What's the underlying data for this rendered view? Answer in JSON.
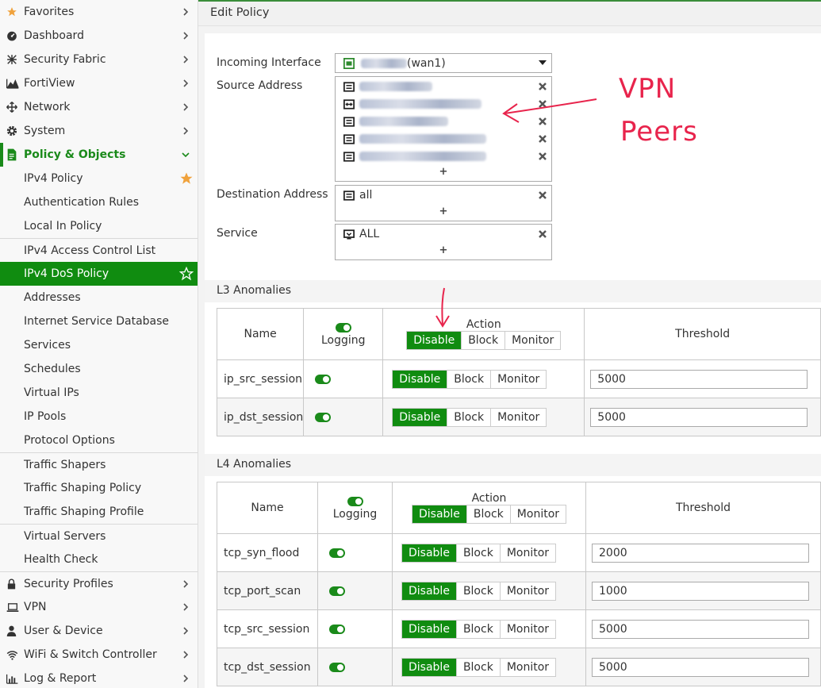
{
  "sidebar": {
    "items": [
      {
        "label": "Favorites"
      },
      {
        "label": "Dashboard"
      },
      {
        "label": "Security Fabric"
      },
      {
        "label": "FortiView"
      },
      {
        "label": "Network"
      },
      {
        "label": "System"
      },
      {
        "label": "Policy & Objects"
      },
      {
        "label": "IPv4 Policy"
      },
      {
        "label": "Authentication Rules"
      },
      {
        "label": "Local In Policy"
      },
      {
        "label": "IPv4 Access Control List"
      },
      {
        "label": "IPv4 DoS Policy"
      },
      {
        "label": "Addresses"
      },
      {
        "label": "Internet Service Database"
      },
      {
        "label": "Services"
      },
      {
        "label": "Schedules"
      },
      {
        "label": "Virtual IPs"
      },
      {
        "label": "IP Pools"
      },
      {
        "label": "Protocol Options"
      },
      {
        "label": "Traffic Shapers"
      },
      {
        "label": "Traffic Shaping Policy"
      },
      {
        "label": "Traffic Shaping Profile"
      },
      {
        "label": "Virtual Servers"
      },
      {
        "label": "Health Check"
      },
      {
        "label": "Security Profiles"
      },
      {
        "label": "VPN"
      },
      {
        "label": "User & Device"
      },
      {
        "label": "WiFi & Switch Controller"
      },
      {
        "label": "Log & Report"
      }
    ]
  },
  "page": {
    "title": "Edit Policy"
  },
  "form": {
    "incoming_label": "Incoming Interface",
    "incoming_value": "(wan1)",
    "source_label": "Source Address",
    "destination_label": "Destination Address",
    "destination_value": "all",
    "service_label": "Service",
    "service_value": "ALL",
    "plus": "+"
  },
  "l3": {
    "title": "L3 Anomalies",
    "col_name": "Name",
    "col_logging": "Logging",
    "col_action": "Action",
    "col_threshold": "Threshold",
    "rows": [
      {
        "name": "ip_src_session",
        "threshold": "5000"
      },
      {
        "name": "ip_dst_session",
        "threshold": "5000"
      }
    ]
  },
  "l4": {
    "title": "L4 Anomalies",
    "col_name": "Name",
    "col_logging": "Logging",
    "col_action": "Action",
    "col_threshold": "Threshold",
    "rows": [
      {
        "name": "tcp_syn_flood",
        "threshold": "2000"
      },
      {
        "name": "tcp_port_scan",
        "threshold": "1000"
      },
      {
        "name": "tcp_src_session",
        "threshold": "5000"
      },
      {
        "name": "tcp_dst_session",
        "threshold": "5000"
      }
    ]
  },
  "actions": {
    "disable": "Disable",
    "block": "Block",
    "monitor": "Monitor"
  },
  "annotation": {
    "line1": "VPN",
    "line2": "Peers"
  },
  "colors": {
    "brand_green": "#108c10",
    "annotation_red": "#e8244c"
  }
}
